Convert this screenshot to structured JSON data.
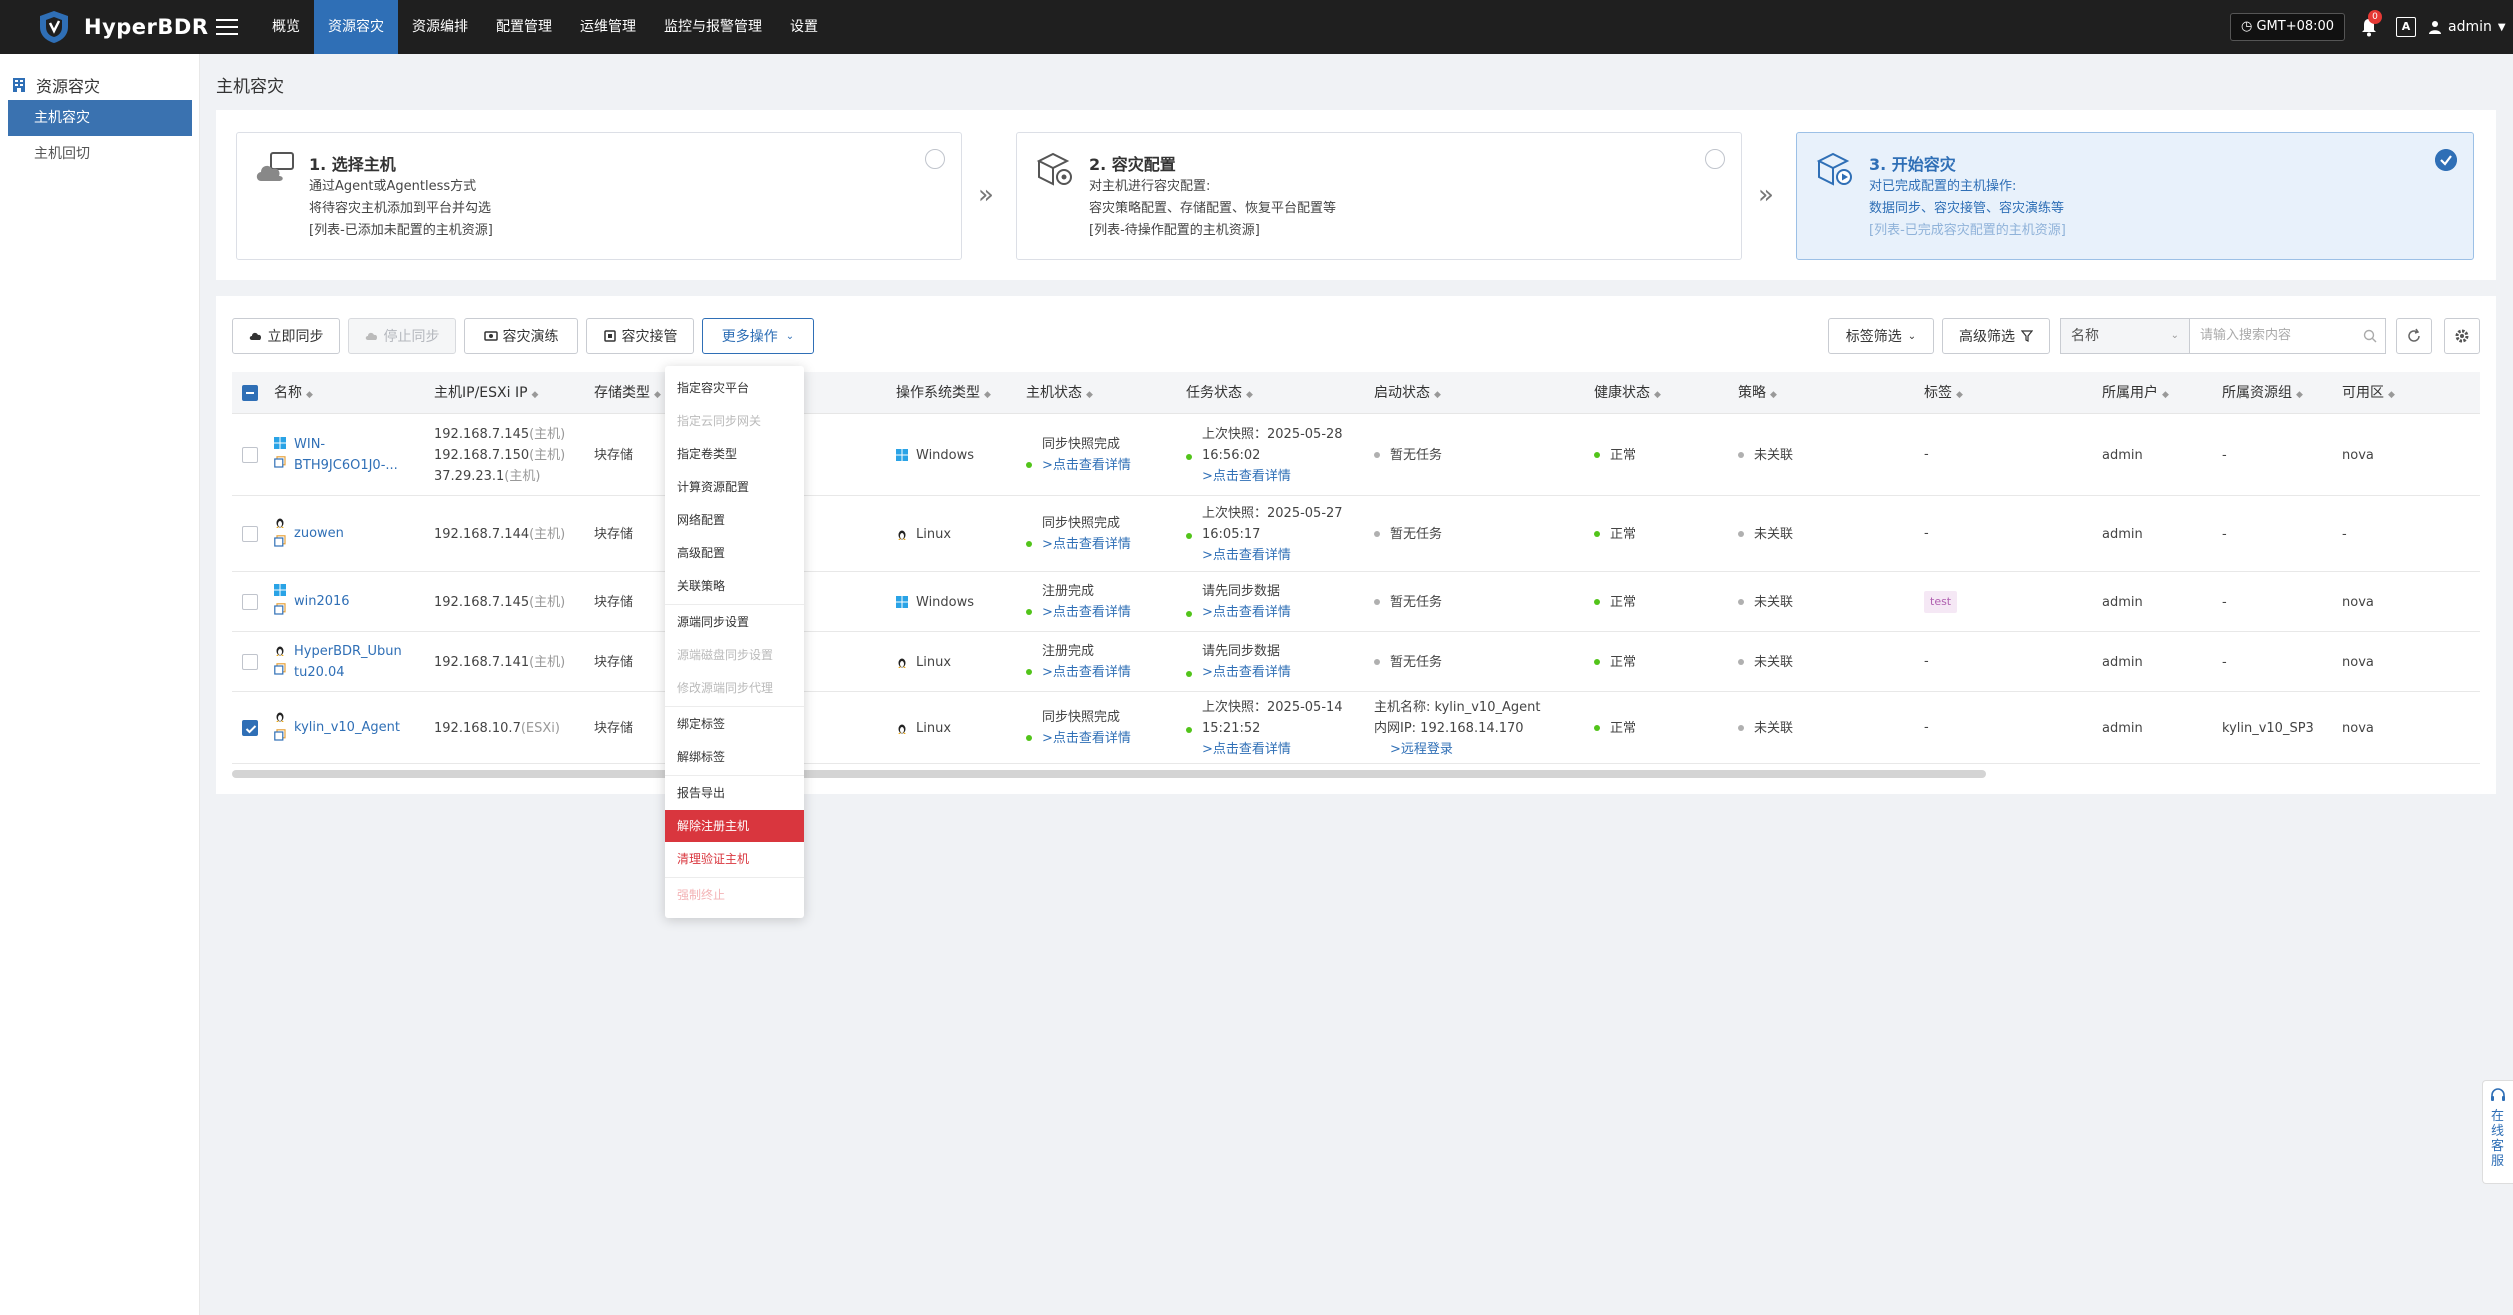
{
  "app": {
    "name": "HyperBDR"
  },
  "nav": [
    {
      "label": "概览",
      "active": false
    },
    {
      "label": "资源容灾",
      "active": true
    },
    {
      "label": "资源编排",
      "active": false
    },
    {
      "label": "配置管理",
      "active": false
    },
    {
      "label": "运维管理",
      "active": false
    },
    {
      "label": "监控与报警管理",
      "active": false
    },
    {
      "label": "设置",
      "active": false
    }
  ],
  "header": {
    "timezone": "GMT+08:00",
    "notification_count": "0",
    "font_icon": "A",
    "user": "admin"
  },
  "sidebar": {
    "title": "资源容灾",
    "items": [
      {
        "label": "主机容灾",
        "active": true
      },
      {
        "label": "主机回切",
        "active": false
      }
    ]
  },
  "page": {
    "title": "主机容灾"
  },
  "steps": [
    {
      "title": "1. 选择主机",
      "lines": [
        "通过Agent或Agentless方式",
        "将待容灾主机添加到平台并勾选",
        "[列表-已添加未配置的主机资源]"
      ],
      "done": false
    },
    {
      "title": "2. 容灾配置",
      "lines": [
        "对主机进行容灾配置:",
        "容灾策略配置、存储配置、恢复平台配置等",
        "[列表-待操作配置的主机资源]"
      ],
      "done": false
    },
    {
      "title": "3. 开始容灾",
      "lines": [
        "对已完成配置的主机操作:",
        "数据同步、容灾接管、容灾演练等",
        "[列表-已完成容灾配置的主机资源]"
      ],
      "done": true
    }
  ],
  "toolbar": {
    "sync_now": "立即同步",
    "stop_sync": "停止同步",
    "drill": "容灾演练",
    "takeover": "容灾接管",
    "more": "更多操作",
    "tag_filter": "标签筛选",
    "advanced_filter": "高级筛选",
    "search_field": "名称",
    "search_placeholder": "请输入搜索内容"
  },
  "table": {
    "columns": [
      "名称",
      "主机IP/ESXi IP",
      "存储类型",
      "操作系统类型",
      "主机状态",
      "任务状态",
      "启动状态",
      "健康状态",
      "策略",
      "标签",
      "所属用户",
      "所属资源组",
      "可用区"
    ],
    "rows": [
      {
        "checked": false,
        "os_icon": "windows-icon",
        "name_lines": [
          "WIN-",
          "BTH9JC6O1J0-..."
        ],
        "ip_lines": [
          [
            "192.168.7.145",
            "(主机)"
          ],
          [
            "192.168.7.150",
            "(主机)"
          ],
          [
            "37.29.23.1",
            "(主机)"
          ]
        ],
        "storage": "块存储",
        "os": "Windows",
        "host_status": "同步快照完成",
        "host_status_link": ">点击查看详情",
        "task_lines": [
          "上次快照：2025-05-28",
          "16:56:02"
        ],
        "task_link": ">点击查看详情",
        "boot_lines": [
          "暂无任务"
        ],
        "boot_link": "",
        "health": "正常",
        "policy": "未关联",
        "tag": "-",
        "tag_is_badge": false,
        "owner": "admin",
        "group": "-",
        "zone": "nova"
      },
      {
        "checked": false,
        "os_icon": "linux-icon",
        "name_lines": [
          "zuowen"
        ],
        "ip_lines": [
          [
            "192.168.7.144",
            "(主机)"
          ]
        ],
        "storage": "块存储",
        "os": "Linux",
        "host_status": "同步快照完成",
        "host_status_link": ">点击查看详情",
        "task_lines": [
          "上次快照：2025-05-27",
          "16:05:17"
        ],
        "task_link": ">点击查看详情",
        "boot_lines": [
          "暂无任务"
        ],
        "boot_link": "",
        "health": "正常",
        "policy": "未关联",
        "tag": "-",
        "tag_is_badge": false,
        "owner": "admin",
        "group": "-",
        "zone": "-"
      },
      {
        "checked": false,
        "os_icon": "windows-icon",
        "name_lines": [
          "win2016"
        ],
        "ip_lines": [
          [
            "192.168.7.145",
            "(主机)"
          ]
        ],
        "storage": "块存储",
        "os": "Windows",
        "host_status": "注册完成",
        "host_status_link": ">点击查看详情",
        "task_lines": [
          "请先同步数据"
        ],
        "task_link": ">点击查看详情",
        "boot_lines": [
          "暂无任务"
        ],
        "boot_link": "",
        "health": "正常",
        "policy": "未关联",
        "tag": "test",
        "tag_is_badge": true,
        "owner": "admin",
        "group": "-",
        "zone": "nova"
      },
      {
        "checked": false,
        "os_icon": "linux-icon",
        "name_lines": [
          "HyperBDR_Ubun",
          "tu20.04"
        ],
        "ip_lines": [
          [
            "192.168.7.141",
            "(主机)"
          ]
        ],
        "storage": "块存储",
        "os": "Linux",
        "host_status": "注册完成",
        "host_status_link": ">点击查看详情",
        "task_lines": [
          "请先同步数据"
        ],
        "task_link": ">点击查看详情",
        "boot_lines": [
          "暂无任务"
        ],
        "boot_link": "",
        "health": "正常",
        "policy": "未关联",
        "tag": "-",
        "tag_is_badge": false,
        "owner": "admin",
        "group": "-",
        "zone": "nova"
      },
      {
        "checked": true,
        "os_icon": "linux-icon",
        "name_lines": [
          "kylin_v10_Agent"
        ],
        "ip_lines": [
          [
            "192.168.10.7",
            "(ESXi)"
          ]
        ],
        "storage": "块存储",
        "os": "Linux",
        "host_status": "同步快照完成",
        "host_status_link": ">点击查看详情",
        "task_lines": [
          "上次快照：2025-05-14",
          "15:21:52"
        ],
        "task_link": ">点击查看详情",
        "boot_lines": [
          "主机名称: kylin_v10_Agent",
          "内网IP: 192.168.14.170"
        ],
        "boot_link": ">远程登录",
        "health": "正常",
        "policy": "未关联",
        "tag": "-",
        "tag_is_badge": false,
        "owner": "admin",
        "group": "kylin_v10_SP3",
        "zone": "nova"
      }
    ]
  },
  "more_menu": [
    {
      "label": "指定容灾平台",
      "state": "normal",
      "sep_before": false
    },
    {
      "label": "指定云同步网关",
      "state": "disabled",
      "sep_before": false
    },
    {
      "label": "指定卷类型",
      "state": "normal",
      "sep_before": false
    },
    {
      "label": "计算资源配置",
      "state": "normal",
      "sep_before": false
    },
    {
      "label": "网络配置",
      "state": "normal",
      "sep_before": false
    },
    {
      "label": "高级配置",
      "state": "normal",
      "sep_before": false
    },
    {
      "label": "关联策略",
      "state": "normal",
      "sep_before": false
    },
    {
      "label": "源端同步设置",
      "state": "normal",
      "sep_before": true
    },
    {
      "label": "源端磁盘同步设置",
      "state": "disabled",
      "sep_before": false
    },
    {
      "label": "修改源端同步代理",
      "state": "disabled",
      "sep_before": false
    },
    {
      "label": "绑定标签",
      "state": "normal",
      "sep_before": true
    },
    {
      "label": "解绑标签",
      "state": "normal",
      "sep_before": false
    },
    {
      "label": "报告导出",
      "state": "normal",
      "sep_before": true
    },
    {
      "label": "解除注册主机",
      "state": "danger-active",
      "sep_before": false
    },
    {
      "label": "清理验证主机",
      "state": "danger",
      "sep_before": false
    },
    {
      "label": "强制终止",
      "state": "danger-disabled",
      "sep_before": true
    }
  ],
  "customer_service": {
    "label": "在线客服"
  },
  "colors": {
    "topbar": "#1f1f1f",
    "primary": "#2f6fb6",
    "danger": "#d9363e",
    "ok": "#52c41a"
  }
}
